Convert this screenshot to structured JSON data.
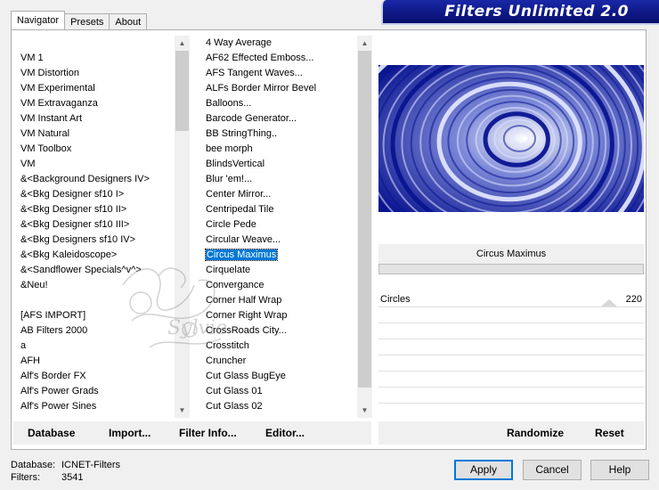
{
  "banner": {
    "title": "Filters Unlimited 2.0"
  },
  "tabs": [
    {
      "label": "Navigator",
      "active": true
    },
    {
      "label": "Presets",
      "active": false
    },
    {
      "label": "About",
      "active": false
    }
  ],
  "categories": {
    "items": [
      "VM 1",
      "VM Distortion",
      "VM Experimental",
      "VM Extravaganza",
      "VM Instant Art",
      "VM Natural",
      "VM Toolbox",
      "VM",
      "&<Background Designers IV>",
      "&<Bkg Designer sf10 I>",
      "&<Bkg Designer sf10 II>",
      "&<Bkg Designer sf10 III>",
      "&<Bkg Designers sf10 IV>",
      "&<Bkg Kaleidoscope>",
      "&<Sandflower Specials^v^>",
      "&Neu!",
      "",
      "[AFS IMPORT]",
      "AB Filters 2000",
      "a",
      "AFH",
      "Alf's Border FX",
      "Alf's Power Grads",
      "Alf's Power Sines"
    ]
  },
  "filters": {
    "selected": "Circus Maximus",
    "items": [
      "4 Way Average",
      "AF62 Effected Emboss...",
      "AFS Tangent Waves...",
      "ALFs Border Mirror Bevel",
      "Balloons...",
      "Barcode Generator...",
      "BB StringThing..",
      "bee morph",
      "BlindsVertical",
      "Blur 'em!...",
      "Center Mirror...",
      "Centripedal Tile",
      "Circle Pede",
      "Circular Weave...",
      "Circus Maximus",
      "Cirquelate",
      "Convergance",
      "Corner Half Wrap",
      "Corner Right Wrap",
      "CrossRoads City...",
      "Crosstitch",
      "Cruncher",
      "Cut Glass  BugEye",
      "Cut Glass 01",
      "Cut Glass 02"
    ]
  },
  "preview": {
    "filter_name": "Circus Maximus"
  },
  "params": [
    {
      "label": "Circles",
      "value": "220"
    }
  ],
  "left_buttons": {
    "database": "Database",
    "import": "Import...",
    "filter_info": "Filter Info...",
    "editor": "Editor..."
  },
  "right_buttons": {
    "randomize": "Randomize",
    "reset": "Reset"
  },
  "status": {
    "database_label": "Database:",
    "database_value": "ICNET-Filters",
    "filters_label": "Filters:",
    "filters_value": "3541"
  },
  "dialog_buttons": {
    "apply": "Apply",
    "cancel": "Cancel",
    "help": "Help"
  },
  "colors": {
    "banner": "#0d1783",
    "selection": "#0078d7",
    "preview_dark": "#0a1490",
    "preview_light": "#e8ecff"
  }
}
